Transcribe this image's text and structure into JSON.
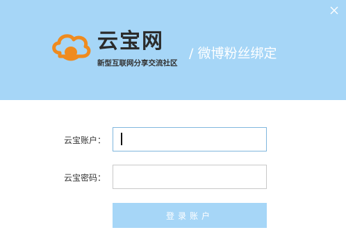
{
  "window": {
    "close_icon": "close-icon"
  },
  "brand": {
    "name": "云宝网",
    "slogan": "新型互联网分享交流社区",
    "logo_icon": "cloud-treasure-logo"
  },
  "page": {
    "title": "/ 微博粉丝绑定"
  },
  "form": {
    "account_label": "云宝账户：",
    "account_value": "",
    "password_label": "云宝密码：",
    "password_value": "",
    "login_button": "登录账户"
  },
  "colors": {
    "header_bg": "#a6d6f7",
    "logo_orange": "#ef8b1f",
    "button_bg": "#a6d6f7"
  }
}
